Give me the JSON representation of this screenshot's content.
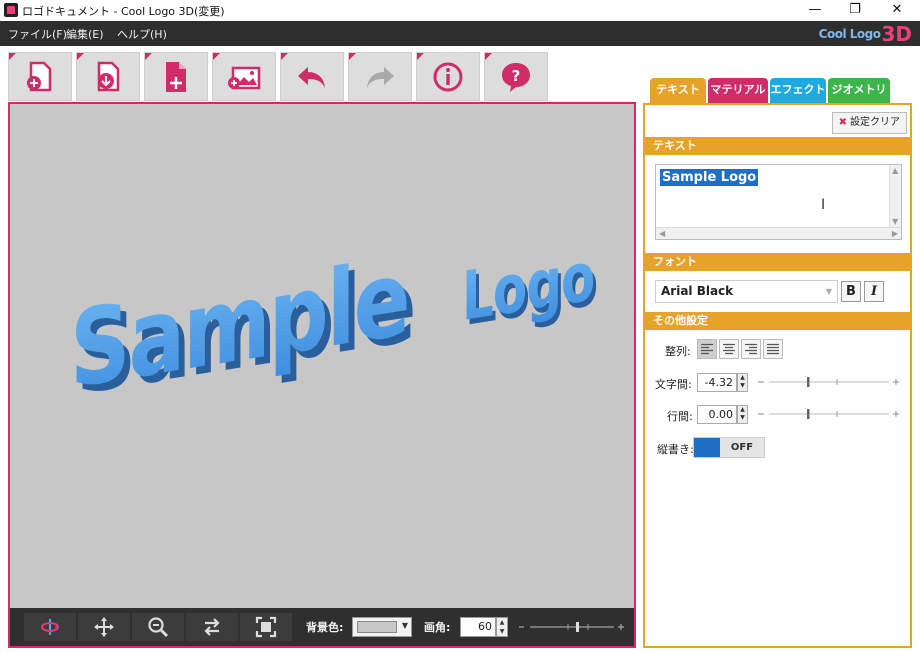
{
  "window": {
    "title": "ロゴドキュメント - Cool Logo 3D(変更)",
    "minimize": "—",
    "restore": "❐",
    "close": "✕"
  },
  "menu": {
    "items": [
      "ファイル(F)",
      "編集(E)",
      "ヘルプ(H)"
    ],
    "brand": "Cool Logo",
    "brand_3d": "3D"
  },
  "toolbar": {
    "buttons": [
      {
        "icon": "new-document-icon"
      },
      {
        "icon": "download-icon"
      },
      {
        "icon": "add-page-icon"
      },
      {
        "icon": "add-image-icon"
      },
      {
        "icon": "undo-icon"
      },
      {
        "icon": "redo-icon"
      },
      {
        "icon": "info-icon"
      },
      {
        "icon": "help-icon"
      }
    ]
  },
  "viewport": {
    "logo_text_1": "Sample",
    "logo_text_2": "Logo",
    "background_color": "#c7c7c7",
    "logo_color": "#4d9ee8"
  },
  "view_toolbar": {
    "bgcolor_label": "背景色:",
    "fov_label": "画角:",
    "fov_value": "60",
    "buttons": [
      "rotate-icon",
      "move-icon",
      "zoom-icon",
      "swap-icon",
      "fit-icon"
    ]
  },
  "panel": {
    "tabs": [
      {
        "label": "テキスト",
        "color": "#e7a22a"
      },
      {
        "label": "マテリアル",
        "color": "#cf2c68"
      },
      {
        "label": "エフェクト",
        "color": "#1fa9e1"
      },
      {
        "label": "ジオメトリ",
        "color": "#3cb54a"
      }
    ],
    "clear_label": "設定クリア",
    "text_section": "テキスト",
    "text_value": "Sample Logo",
    "font_section": "フォント",
    "font_value": "Arial Black",
    "bold": "B",
    "italic": "I",
    "other_section": "その他設定",
    "align_label": "整列:",
    "spacing_label": "文字間:",
    "spacing_value": "-4.32",
    "line_label": "行間:",
    "line_value": "0.00",
    "vertical_label": "縦書き:",
    "vertical_state": "OFF"
  }
}
